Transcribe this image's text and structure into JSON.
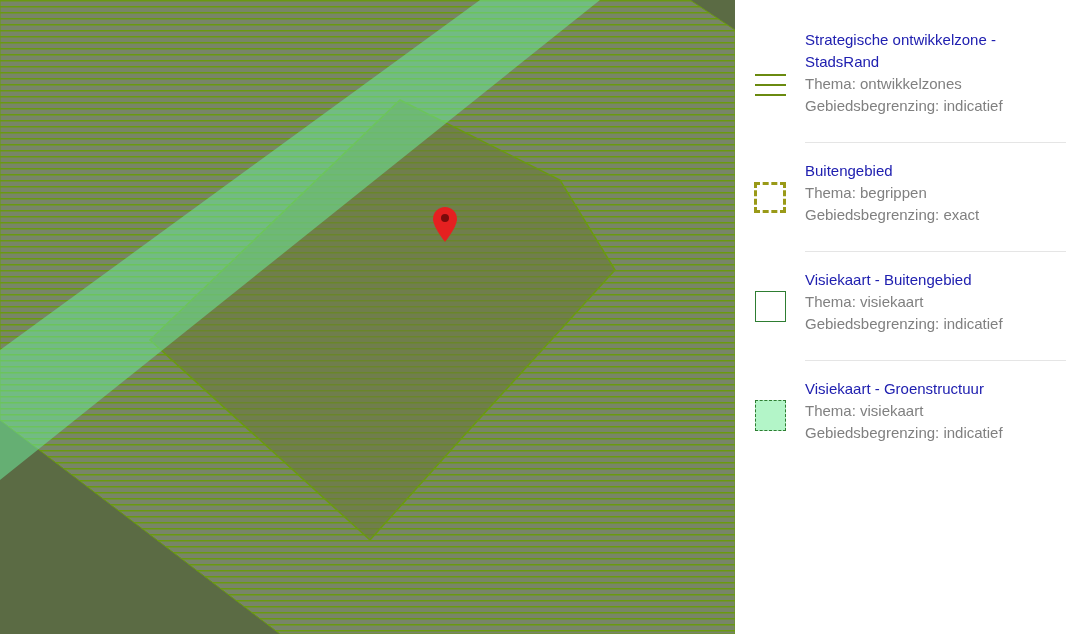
{
  "legend": [
    {
      "kind": "hatch",
      "title": "Strategische ontwikkelzone - StadsRand",
      "theme": "Thema: ontwikkelzones",
      "boundary": "Gebiedsbegrenzing: indicatief"
    },
    {
      "kind": "dashed",
      "title": "Buitengebied",
      "theme": "Thema: begrippen",
      "boundary": "Gebiedsbegrenzing: exact"
    },
    {
      "kind": "outline",
      "title": "Visiekaart - Buitengebied",
      "theme": "Thema: visiekaart",
      "boundary": "Gebiedsbegrenzing: indicatief"
    },
    {
      "kind": "dashed-fill",
      "title": "Visiekaart - Groenstructuur",
      "theme": "Thema: visiekaart",
      "boundary": "Gebiedsbegrenzing: indicatief"
    }
  ]
}
